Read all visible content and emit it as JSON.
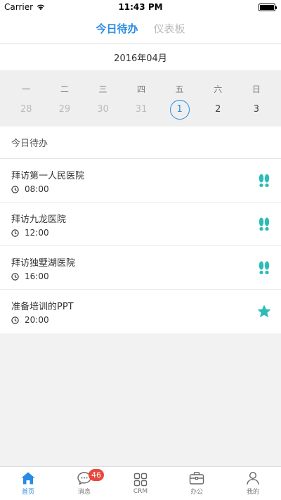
{
  "status_bar": {
    "carrier": "Carrier",
    "time": "11:43 PM"
  },
  "top_tabs": [
    {
      "label": "今日待办",
      "active": true
    },
    {
      "label": "仪表板",
      "active": false
    }
  ],
  "calendar": {
    "month_label": "2016年04月",
    "weekday_names": [
      "一",
      "二",
      "三",
      "四",
      "五",
      "六",
      "日"
    ],
    "dates": [
      "28",
      "29",
      "30",
      "31",
      "1",
      "2",
      "3"
    ],
    "selected_date": "1"
  },
  "section": {
    "title": "今日待办"
  },
  "tasks": [
    {
      "title": "拜访第一人民医院",
      "time": "08:00",
      "icon": "footprints-icon"
    },
    {
      "title": "拜访九龙医院",
      "time": "12:00",
      "icon": "footprints-icon"
    },
    {
      "title": "拜访独墅湖医院",
      "time": "16:00",
      "icon": "footprints-icon"
    },
    {
      "title": "准备培训的PPT",
      "time": "20:00",
      "icon": "star-icon"
    }
  ],
  "tab_bar": {
    "items": [
      {
        "label": "首页",
        "icon": "home-icon",
        "active": true
      },
      {
        "label": "消息",
        "icon": "chat-icon",
        "badge": "46"
      },
      {
        "label": "CRM",
        "icon": "grid-icon"
      },
      {
        "label": "办公",
        "icon": "briefcase-icon"
      },
      {
        "label": "我的",
        "icon": "user-icon"
      }
    ]
  },
  "colors": {
    "accent": "#2a8be2",
    "teal": "#2bbcb7",
    "badge": "#e8483d"
  }
}
